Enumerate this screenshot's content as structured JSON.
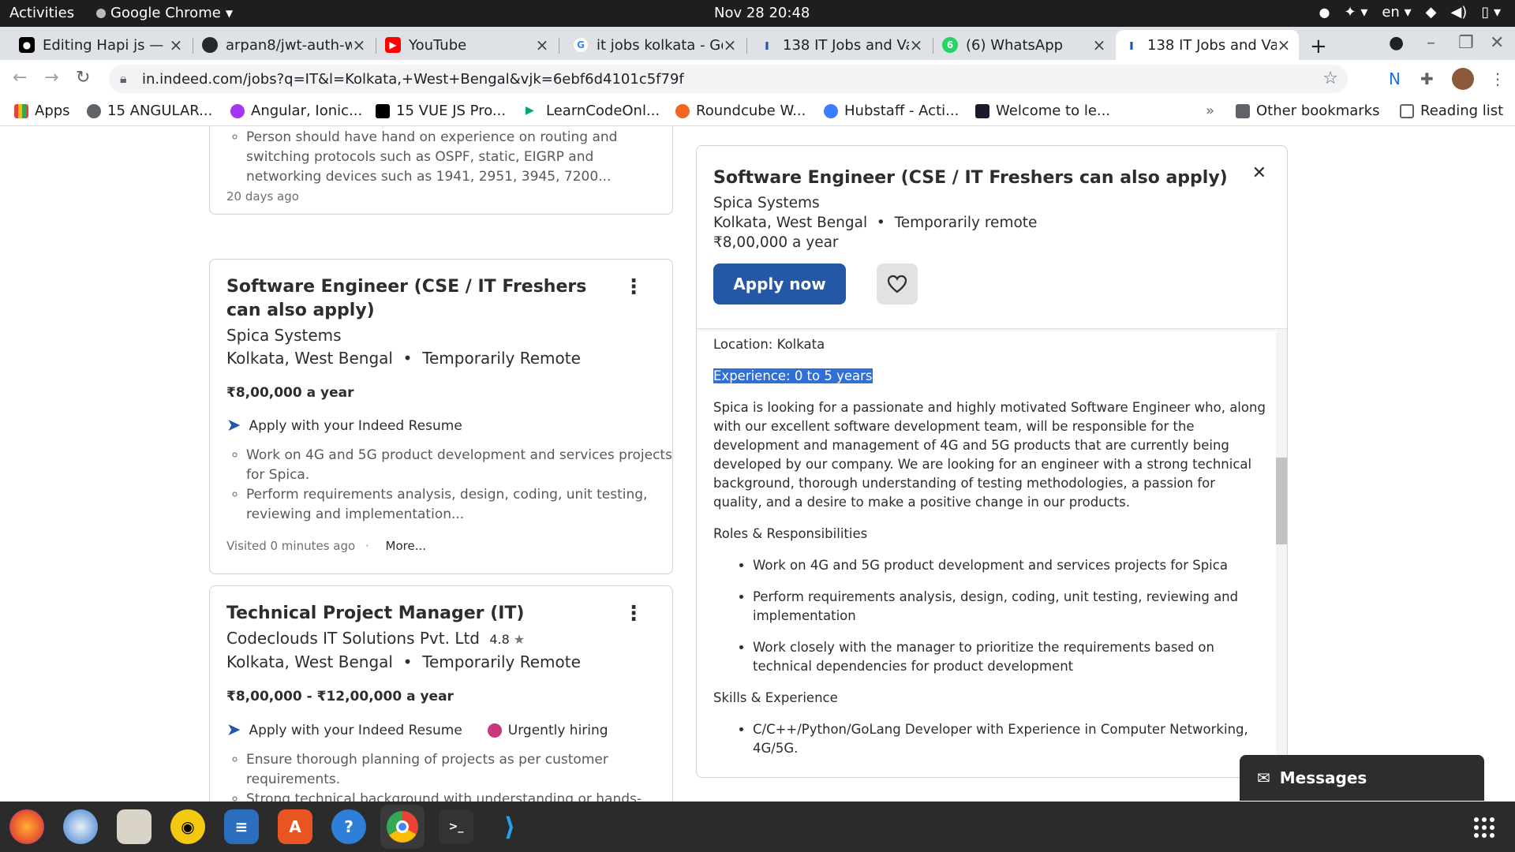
{
  "system": {
    "activities": "Activities",
    "app_name": "Google Chrome",
    "clock": "Nov 28  20:48",
    "lang": "en"
  },
  "tabs": [
    {
      "title": "Editing Hapi js — ",
      "icon": "medium-icon"
    },
    {
      "title": "arpan8/jwt-auth-w",
      "icon": "github-icon"
    },
    {
      "title": "YouTube",
      "icon": "youtube-icon"
    },
    {
      "title": "it jobs kolkata - Go",
      "icon": "google-icon"
    },
    {
      "title": "138 IT Jobs and Va",
      "icon": "indeed-icon"
    },
    {
      "title": "(6) WhatsApp",
      "icon": "whatsapp-icon"
    },
    {
      "title": "138 IT Jobs and Va",
      "icon": "indeed-icon"
    }
  ],
  "url": "in.indeed.com/jobs?q=IT&l=Kolkata,+West+Bengal&vjk=6ebf6d4101c5f79f",
  "bookmarks": [
    {
      "label": "Apps"
    },
    {
      "label": "15 ANGULAR..."
    },
    {
      "label": "Angular, Ionic..."
    },
    {
      "label": "15 VUE JS Pro..."
    },
    {
      "label": "LearnCodeOnl..."
    },
    {
      "label": "Roundcube W..."
    },
    {
      "label": "Hubstaff - Acti..."
    },
    {
      "label": "Welcome to le..."
    }
  ],
  "bookmarks_more": "»",
  "other_bookmarks": "Other bookmarks",
  "reading_list": "Reading list",
  "card_prev": {
    "bullet": "Person should have hand on experience on routing and switching protocols such as OSPF, static, EIGRP and networking devices such as 1941, 2951, 3945, 7200...",
    "age": "20 days ago"
  },
  "card1": {
    "title": "Software Engineer (CSE / IT Freshers can also apply)",
    "company": "Spica Systems",
    "location": "Kolkata, West Bengal",
    "remote": "Temporarily Remote",
    "salary": "₹8,00,000 a year",
    "apply": "Apply with your Indeed Resume",
    "bullets": [
      "Work on 4G and 5G product development and services projects for Spica.",
      "Perform requirements analysis, design, coding, unit testing, reviewing and implementation..."
    ],
    "visited": "Visited 0 minutes ago",
    "more": "More..."
  },
  "card2": {
    "title": "Technical Project Manager (IT)",
    "company": "Codeclouds IT Solutions Pvt. Ltd",
    "rating": "4.8",
    "location": "Kolkata, West Bengal",
    "remote": "Temporarily Remote",
    "salary": "₹8,00,000 - ₹12,00,000 a year",
    "apply": "Apply with your Indeed Resume",
    "urgent": "Urgently hiring",
    "bullets": [
      "Ensure thorough planning of projects as per customer requirements.",
      "Strong technical background with understanding or hands-"
    ]
  },
  "detail": {
    "title": "Software Engineer (CSE / IT Freshers can also apply)",
    "company": "Spica Systems",
    "location": "Kolkata, West Bengal",
    "remote": "Temporarily remote",
    "salary": "₹8,00,000 a year",
    "apply_label": "Apply now",
    "location_line": "Location: Kolkata",
    "experience_line": "Experience: 0 to 5 years",
    "description": "Spica is looking for a passionate and highly motivated Software Engineer who, along with our excellent software development team, will be responsible for the development and management of 4G and 5G products that are currently being developed by our company. We are looking for an engineer with a strong technical background, thorough understanding of testing methodologies, a passion for quality, and a desire to make a positive change in our products.",
    "roles_heading": "Roles & Responsibilities",
    "roles": [
      "Work on 4G and 5G product development and services projects for Spica",
      "Perform requirements analysis, design, coding, unit testing, reviewing and implementation",
      "Work closely with the manager to prioritize the requirements based on technical dependencies for product development"
    ],
    "skills_heading": "Skills & Experience",
    "skills": [
      "C/C++/Python/GoLang Developer with Experience in Computer Networking, 4G/5G."
    ]
  },
  "messages_label": "Messages",
  "colors": {
    "indeed_blue": "#2557a7",
    "selection": "#2f6fd6"
  }
}
